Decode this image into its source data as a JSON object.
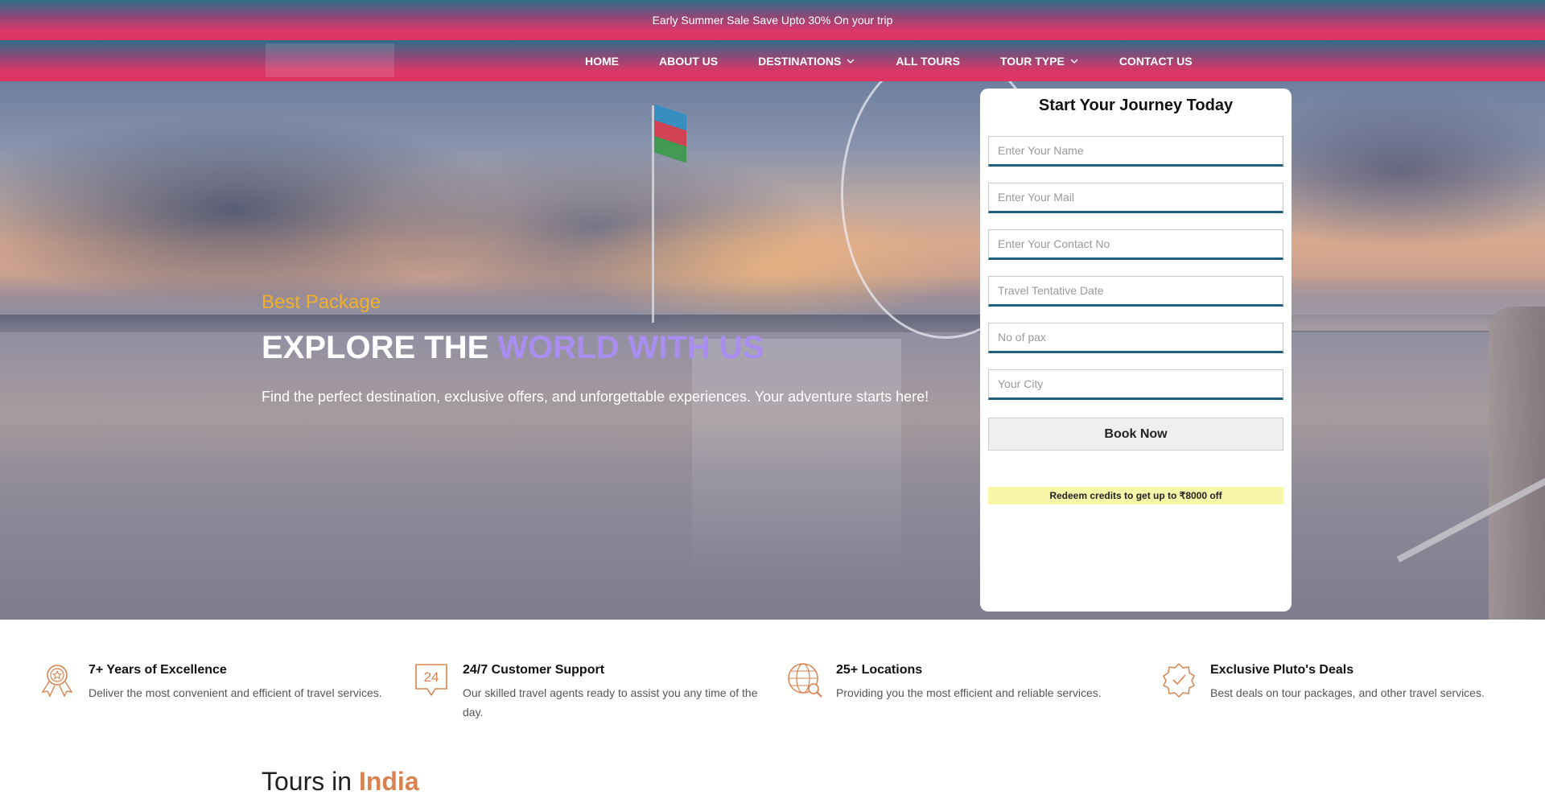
{
  "promo": {
    "text": "Early Summer Sale Save Upto 30% On your trip"
  },
  "nav": {
    "items": [
      {
        "label": "HOME",
        "dropdown": false
      },
      {
        "label": "ABOUT US",
        "dropdown": false
      },
      {
        "label": "DESTINATIONS",
        "dropdown": true
      },
      {
        "label": "ALL TOURS",
        "dropdown": false
      },
      {
        "label": "TOUR TYPE",
        "dropdown": true
      },
      {
        "label": "CONTACT US",
        "dropdown": false
      }
    ]
  },
  "hero": {
    "subtitle": "Best Package",
    "title_part1": "EXPLORE THE ",
    "title_accent": "WORLD WITH US",
    "title_glyph": "",
    "description": "Find the perfect destination, exclusive offers, and unforgettable experiences. Your adventure starts here!"
  },
  "booking": {
    "title": "Start Your Journey Today",
    "fields": {
      "name_placeholder": "Enter Your Name",
      "mail_placeholder": "Enter Your Mail",
      "contact_placeholder": "Enter Your Contact No",
      "date_placeholder": "Travel Tentative Date",
      "pax_placeholder": "No of pax",
      "city_placeholder": "Your City"
    },
    "button": "Book Now",
    "redeem": "Redeem credits to get up to ₹8000 off"
  },
  "features": [
    {
      "icon": "award-ribbon-icon",
      "title": "7+ Years of Excellence",
      "desc": "Deliver the most convenient and efficient of travel services."
    },
    {
      "icon": "support-24-icon",
      "title": "24/7 Customer Support",
      "desc": "Our skilled travel agents ready to assist you any time of the day."
    },
    {
      "icon": "globe-search-icon",
      "title": "25+ Locations",
      "desc": "Providing you the most efficient and reliable services."
    },
    {
      "icon": "badge-check-icon",
      "title": "Exclusive Pluto's Deals",
      "desc": "Best deals on tour packages, and other travel services."
    }
  ],
  "tours": {
    "prefix": "Tours in ",
    "accent": "India"
  },
  "colors": {
    "accent_orange": "#d8834f",
    "hero_gold": "#f0b02a",
    "hero_purple": "#a98ef0",
    "field_underline": "#1f5f80",
    "redeem_bg": "#f8f6a8"
  }
}
